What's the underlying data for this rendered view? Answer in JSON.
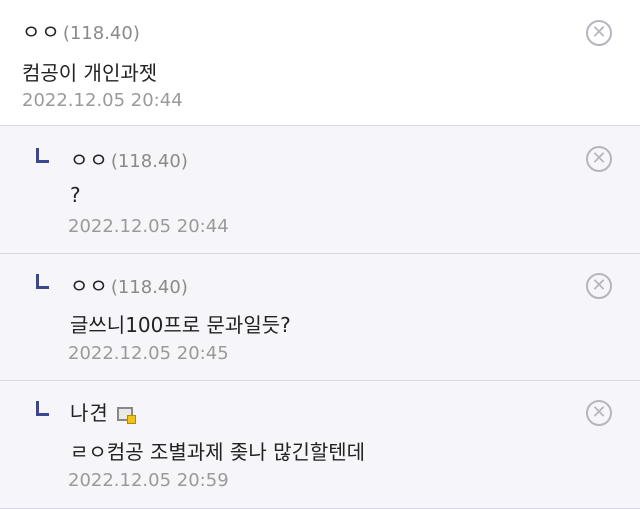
{
  "comments": [
    {
      "nick": "ㅇㅇ",
      "ip": "(118.40)",
      "text": "컴공이 개인과젯",
      "date": "2022.12.05 20:44",
      "delete_icon": "close-circle-icon"
    },
    {
      "nick": "ㅇㅇ",
      "ip": "(118.40)",
      "text": "?",
      "date": "2022.12.05 20:44",
      "reply_icon": "reply-arrow-icon",
      "delete_icon": "close-circle-icon"
    },
    {
      "nick": "ㅇㅇ",
      "ip": "(118.40)",
      "text": "글쓰니100프로 문과일듯?",
      "date": "2022.12.05 20:45",
      "reply_icon": "reply-arrow-icon",
      "delete_icon": "close-circle-icon"
    },
    {
      "nick": "나견",
      "text": "ㄹㅇ컴공 조별과제 좆나 많긴할텐데",
      "date": "2022.12.05 20:59",
      "reply_icon": "reply-arrow-icon",
      "member_badge": "fixed-nick-badge-icon",
      "delete_icon": "close-circle-icon"
    }
  ],
  "colors": {
    "reply_arrow": "#3b4890",
    "date": "#9a9a9a",
    "reply_bg": "#f6f6fa",
    "divider": "#d9d9e6"
  }
}
